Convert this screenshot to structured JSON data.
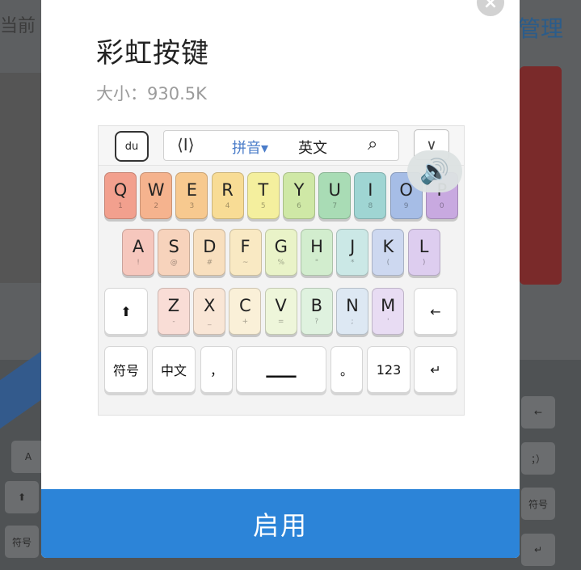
{
  "background": {
    "left_text": "当前",
    "right_text": "管理",
    "keys_bottom": [
      "符号",
      "←",
      "；）",
      "符号",
      "↵",
      "⬆",
      "A"
    ]
  },
  "dialog": {
    "close_icon": "×",
    "title": "彩虹按键",
    "size_label": "大小：930.5K",
    "enable_label": "启用"
  },
  "keyboard": {
    "logo": "du",
    "cursor_icon": "⟨I⟩",
    "pinyin_label": "拼音▾",
    "english_label": "英文",
    "search_icon": "⌕",
    "collapse_icon": "∨",
    "volume_icon": "🔊",
    "row1": [
      {
        "l": "Q",
        "s": "1",
        "c": "#f2a08e"
      },
      {
        "l": "W",
        "s": "2",
        "c": "#f5b38e"
      },
      {
        "l": "E",
        "s": "3",
        "c": "#f7c98f"
      },
      {
        "l": "R",
        "s": "4",
        "c": "#f8dc95"
      },
      {
        "l": "T",
        "s": "5",
        "c": "#f4ef9e"
      },
      {
        "l": "Y",
        "s": "6",
        "c": "#cfe8a6"
      },
      {
        "l": "U",
        "s": "7",
        "c": "#a9dcb5"
      },
      {
        "l": "I",
        "s": "8",
        "c": "#9fd5d3"
      },
      {
        "l": "O",
        "s": "9",
        "c": "#a6bde6"
      },
      {
        "l": "P",
        "s": "0",
        "c": "#c8a9e0"
      }
    ],
    "row2": [
      {
        "l": "A",
        "s": "!",
        "c": "#f6c7bd"
      },
      {
        "l": "S",
        "s": "@",
        "c": "#f7d3bc"
      },
      {
        "l": "D",
        "s": "#",
        "c": "#f8dfbe"
      },
      {
        "l": "F",
        "s": "~",
        "c": "#f9e9c3"
      },
      {
        "l": "G",
        "s": "%",
        "c": "#e9f3c8"
      },
      {
        "l": "H",
        "s": "\"",
        "c": "#d2edce"
      },
      {
        "l": "J",
        "s": "*",
        "c": "#cbe8e6"
      },
      {
        "l": "K",
        "s": "(",
        "c": "#cdd8f0"
      },
      {
        "l": "L",
        "s": ")",
        "c": "#ddcdef"
      }
    ],
    "row3": [
      {
        "l": "Z",
        "s": "-",
        "c": "#f9ddd6"
      },
      {
        "l": "X",
        "s": "_",
        "c": "#f9e6d6"
      },
      {
        "l": "C",
        "s": "+",
        "c": "#faf0d8"
      },
      {
        "l": "V",
        "s": "=",
        "c": "#eef6da"
      },
      {
        "l": "B",
        "s": "?",
        "c": "#dff2df"
      },
      {
        "l": "N",
        "s": ";",
        "c": "#dde8f3"
      },
      {
        "l": "M",
        "s": "'",
        "c": "#e8dcf3"
      }
    ],
    "shift": "⬆",
    "backspace": "←",
    "fuhao": "符号",
    "zhongwen": "中文",
    "comma": "，",
    "space": "▁▁▁",
    "period": "。",
    "num": "123",
    "enter": "↵"
  }
}
